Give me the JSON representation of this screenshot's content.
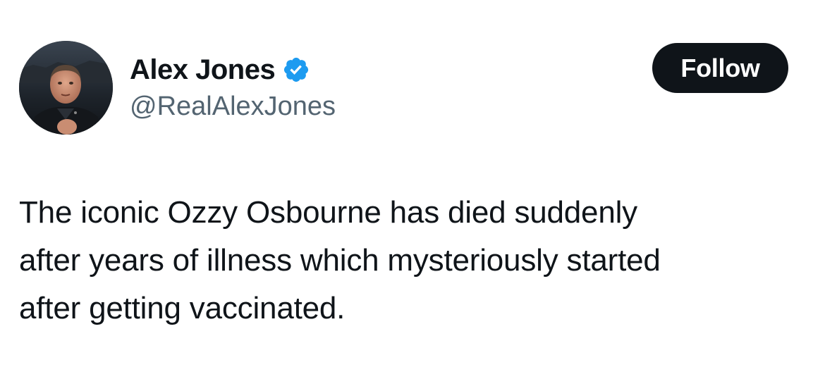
{
  "author": {
    "display_name": "Alex Jones",
    "handle": "@RealAlexJones",
    "verified": true,
    "avatar_icon": "profile-photo"
  },
  "follow_button": {
    "label": "Follow"
  },
  "tweet": {
    "lines": [
      "The iconic Ozzy Osbourne has died suddenly",
      "after years of illness which mysteriously started",
      "after getting vaccinated."
    ]
  },
  "colors": {
    "text_primary": "#0f1419",
    "text_secondary": "#536471",
    "verified_badge": "#1d9bf0",
    "button_bg": "#0f1419",
    "button_text": "#ffffff",
    "background": "#ffffff"
  }
}
